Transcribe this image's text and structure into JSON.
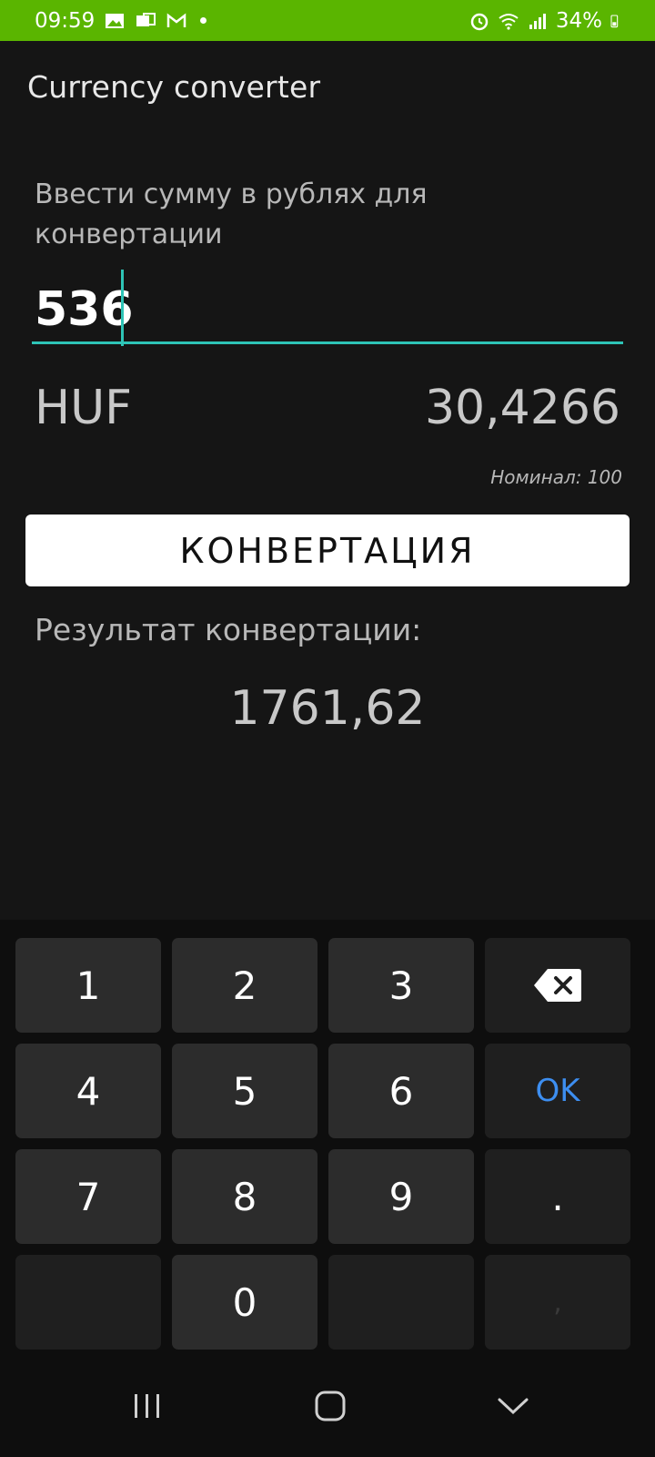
{
  "status_bar": {
    "time": "09:59",
    "battery": "34%"
  },
  "app": {
    "title": "Currency converter"
  },
  "form": {
    "input_label": "Ввести сумму в рублях для конвертации",
    "amount_value": "536",
    "currency_code": "HUF",
    "currency_rate": "30,4266",
    "nominal": "Номинал: 100",
    "convert_label": "КОНВЕРТАЦИЯ",
    "result_label": "Результат конвертации:",
    "result_value": "1761,62"
  },
  "keyboard": {
    "keys": [
      "1",
      "2",
      "3",
      "4",
      "5",
      "6",
      "7",
      "8",
      "9",
      "0"
    ],
    "ok_label": "OK",
    "dot_label": ".",
    "comma_label": ","
  },
  "colors": {
    "status_bar": "#5ab500",
    "accent": "#2ec4b6",
    "ok_key": "#3d8ef0",
    "background": "#151515"
  },
  "icons": [
    "image-icon",
    "mail-icon",
    "gmail-icon",
    "alarm-icon",
    "wifi-icon",
    "signal-icon",
    "battery-icon",
    "backspace-icon",
    "recents-icon",
    "home-icon",
    "back-icon"
  ]
}
